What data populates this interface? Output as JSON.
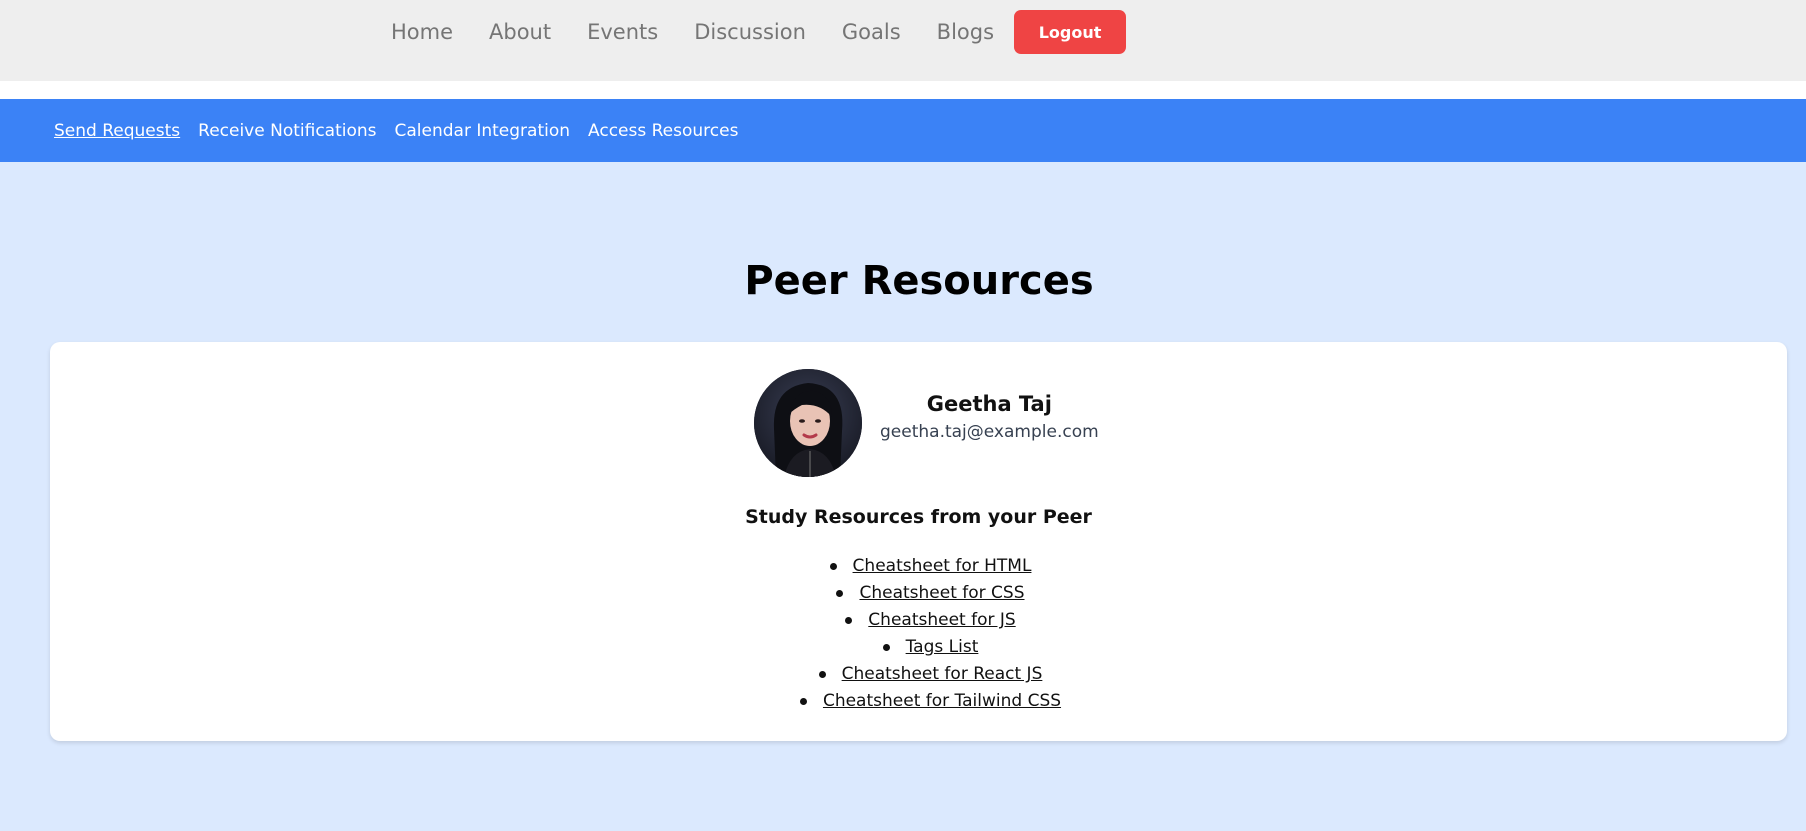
{
  "topnav": {
    "links": [
      "Home",
      "About",
      "Events",
      "Discussion",
      "Goals",
      "Blogs"
    ],
    "logout_label": "Logout"
  },
  "subnav": {
    "links": [
      "Send Requests",
      "Receive Notifications",
      "Calendar Integration",
      "Access Resources"
    ],
    "active": "Send Requests"
  },
  "page": {
    "title": "Peer Resources"
  },
  "profile": {
    "name": "Geetha Taj",
    "email": "geetha.taj@example.com"
  },
  "resources": {
    "heading": "Study Resources from your Peer",
    "items": [
      "Cheatsheet for HTML",
      "Cheatsheet for CSS",
      "Cheatsheet for JS",
      "Tags List",
      "Cheatsheet for React JS",
      "Cheatsheet for Tailwind CSS"
    ]
  },
  "colors": {
    "page_bg": "#dbe9fe",
    "topbar_bg": "#eeeeee",
    "subnav_bg": "#3b82f6",
    "logout_bg": "#ef4444"
  }
}
